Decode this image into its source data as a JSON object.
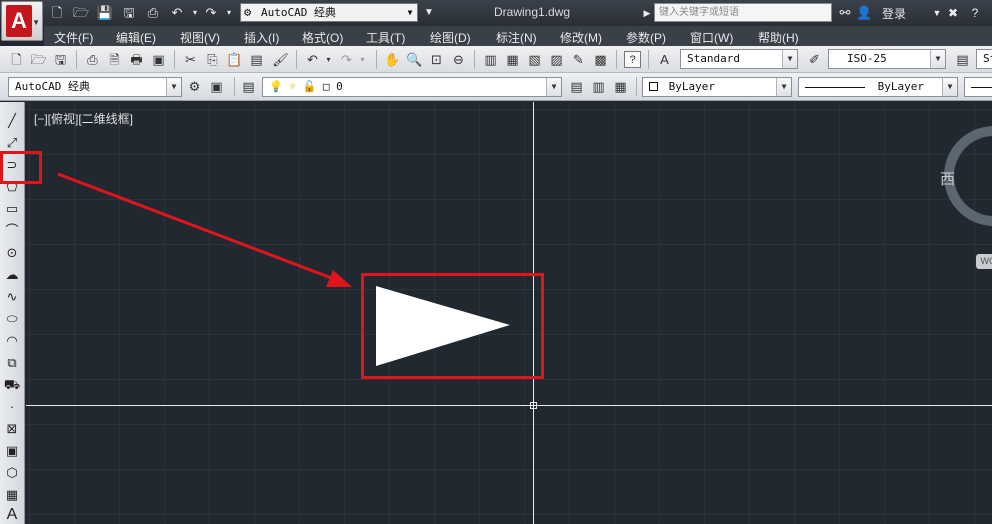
{
  "titlebar": {
    "workspace": "AutoCAD 经典",
    "file_title": "Drawing1.dwg",
    "search_placeholder": "键入关键字或短语",
    "login": "登录"
  },
  "menu": [
    "文件(F)",
    "编辑(E)",
    "视图(V)",
    "插入(I)",
    "格式(O)",
    "工具(T)",
    "绘图(D)",
    "标注(N)",
    "修改(M)",
    "参数(P)",
    "窗口(W)",
    "帮助(H)"
  ],
  "toolbar1": {
    "text_style": "Standard",
    "dim_style": "ISO-25",
    "extra_style": "St"
  },
  "toolbar2": {
    "workspace": "AutoCAD 经典",
    "layer": "0",
    "color": "ByLayer",
    "linetype": "ByLayer"
  },
  "viewport": {
    "label": "[−][俯视][二维线框]",
    "viewcube_west": "西",
    "wcs": "WCS"
  },
  "colors": {
    "canvas_bg": "#212830",
    "highlight": "#e0151b",
    "autocad_red": "#c4161c"
  }
}
